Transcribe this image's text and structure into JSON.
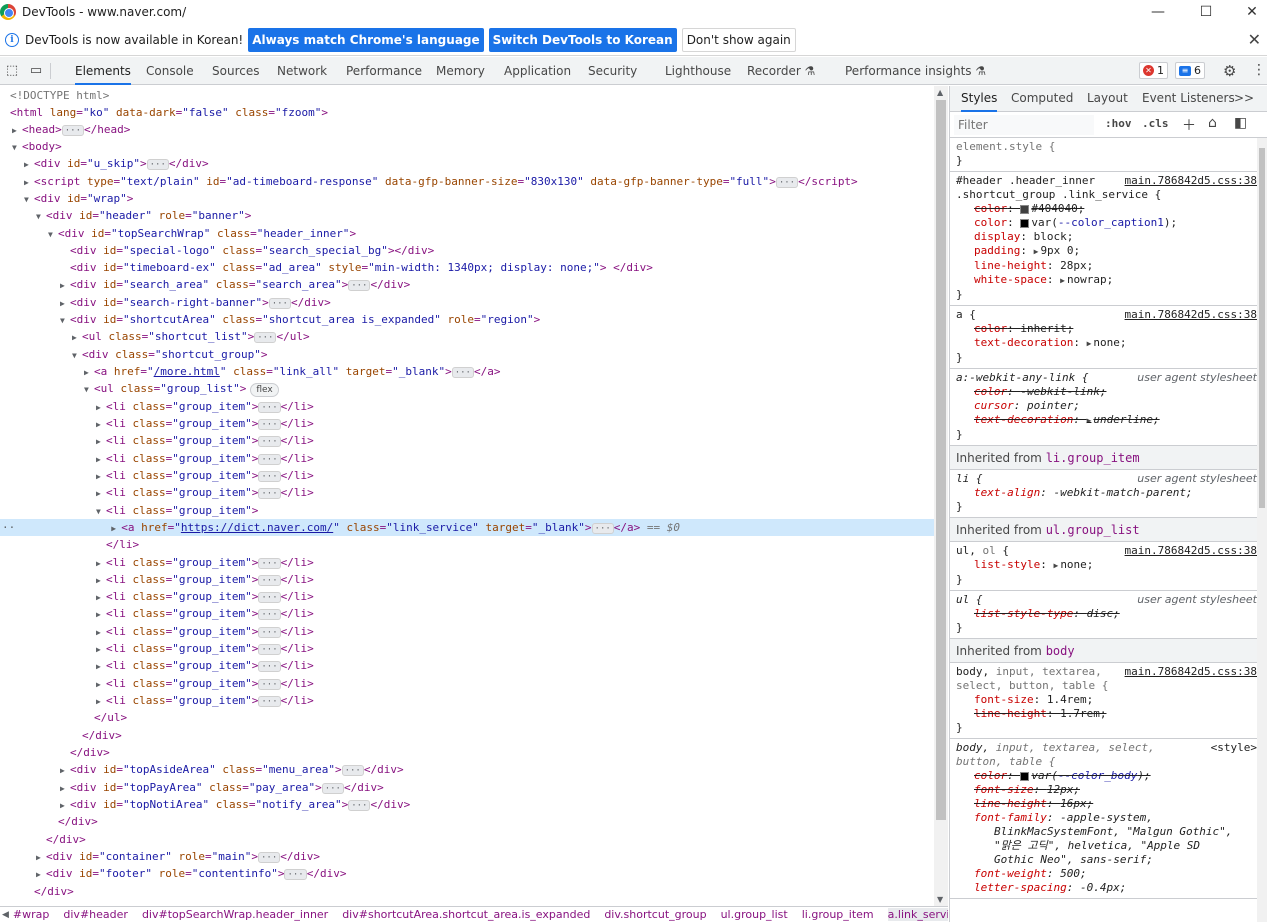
{
  "window": {
    "title": "DevTools - www.naver.com/",
    "controls": [
      "—",
      "☐",
      "✕"
    ]
  },
  "infobar": {
    "message": "DevTools is now available in Korean!",
    "btn_match": "Always match Chrome's language",
    "btn_switch": "Switch DevTools to Korean",
    "btn_dont_show": "Don't show again"
  },
  "tabs": {
    "elements": "Elements",
    "console": "Console",
    "sources": "Sources",
    "network": "Network",
    "performance": "Performance",
    "memory": "Memory",
    "application": "Application",
    "security": "Security",
    "lighthouse": "Lighthouse",
    "recorder": "Recorder",
    "perf_insights": "Performance insights",
    "errors_count": "1",
    "messages_count": "6"
  },
  "dom": {
    "l0": "<!DOCTYPE html>",
    "l1_lang": "\"ko\"",
    "l1_dark": "\"false\"",
    "l1_class": "\"fzoom\"",
    "selected_suffix": "== $0",
    "href_more": "/more.html",
    "href_dict": "https://dict.naver.com/",
    "flex": "flex"
  },
  "breadcrumb": [
    {
      "tag": "#wrap",
      "cls": ""
    },
    {
      "tag": "div",
      "cls": "#header"
    },
    {
      "tag": "div",
      "cls": "#topSearchWrap.header_inner"
    },
    {
      "tag": "div",
      "cls": "#shortcutArea.shortcut_area.is_expanded"
    },
    {
      "tag": "div",
      "cls": ".shortcut_group"
    },
    {
      "tag": "ul",
      "cls": ".group_list"
    },
    {
      "tag": "li",
      "cls": ".group_item"
    },
    {
      "tag": "a",
      "cls": ".link_service"
    }
  ],
  "sidebar": {
    "tabs": [
      "Styles",
      "Computed",
      "Layout",
      "Event Listeners",
      ">>"
    ],
    "filter_placeholder": "Filter",
    "hov": ":hov",
    "cls": ".cls",
    "source_main": "main.786842d5.css:38",
    "ua_sheet": "user agent stylesheet",
    "style_tag": "<style>",
    "inherited_li": "li.group_item",
    "inherited_ul": "ul.group_list",
    "inherited_body": "body",
    "inherited_label": "Inherited from"
  },
  "colors": {
    "accent": "#1a73e8",
    "tag": "#881280",
    "attr": "#994500",
    "value": "#1a1aa6",
    "selected_row": "#cfe8fc",
    "swatch_dark": "#404040",
    "swatch_black": "#000000"
  }
}
